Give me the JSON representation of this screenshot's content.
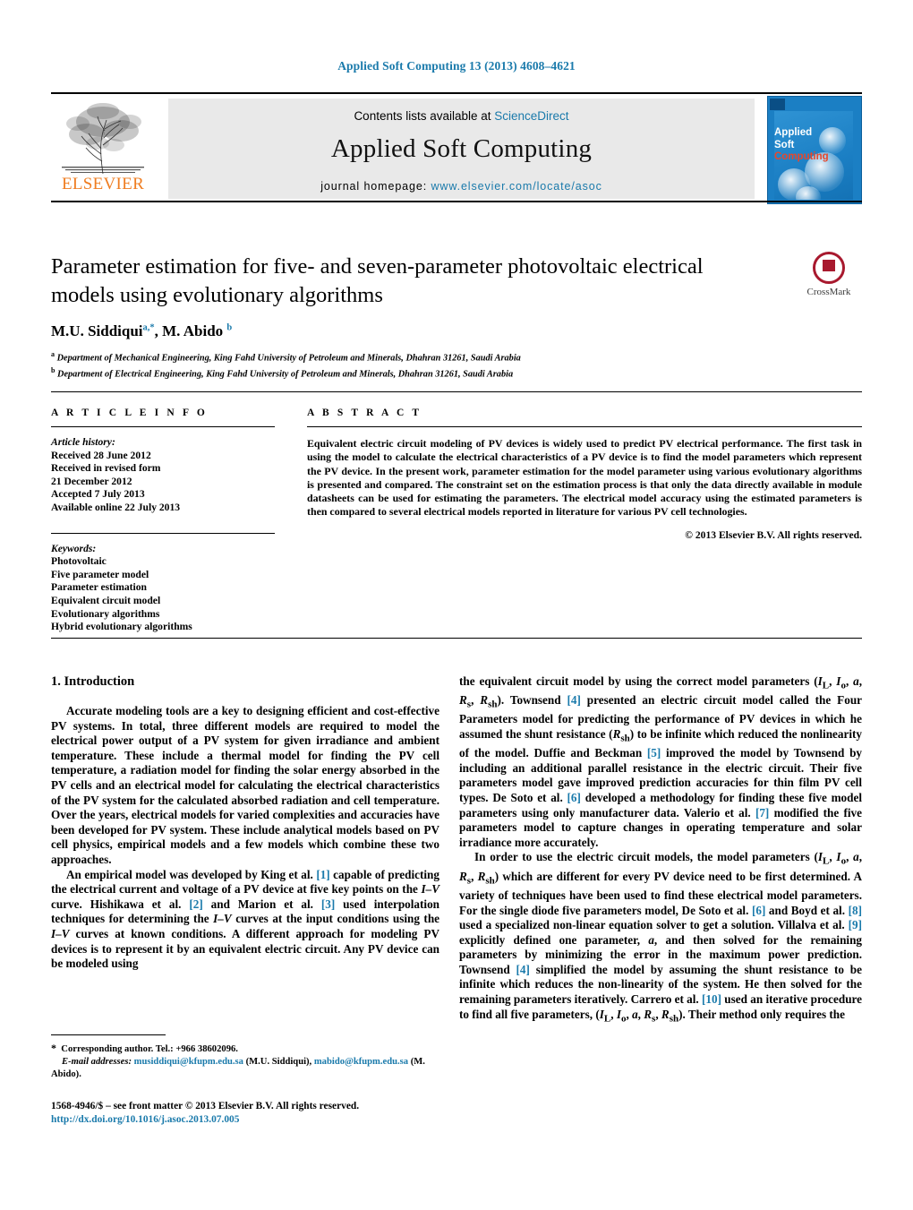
{
  "running_head": "Applied Soft Computing 13 (2013) 4608–4621",
  "masthead": {
    "contents_prefix": "Contents lists available at ",
    "sciencedirect": "ScienceDirect",
    "journal_title": "Applied Soft Computing",
    "homepage_prefix": "journal homepage: ",
    "homepage_url": "www.elsevier.com/locate/asoc",
    "publisher": "ELSEVIER",
    "cover": {
      "line1": "Applied",
      "line2": "Soft",
      "line3": "Computing"
    },
    "accent_color": "#1a7aab",
    "publisher_color": "#ef7d21",
    "cover_bg": "#1b7fc4",
    "cover_accent": "#e8472a"
  },
  "article": {
    "title": "Parameter estimation for five- and seven-parameter photovoltaic electrical models using evolutionary algorithms",
    "authors_html": "M.U. Siddiqui<sup>a,*</sup>, M. Abido <sup>b</sup>",
    "affiliation_a": "Department of Mechanical Engineering, King Fahd University of Petroleum and Minerals, Dhahran 31261, Saudi Arabia",
    "affiliation_b": "Department of Electrical Engineering, King Fahd University of Petroleum and Minerals, Dhahran 31261, Saudi Arabia",
    "crossmark_label": "CrossMark"
  },
  "article_info": {
    "heading": "A R T I C L E  I N F O",
    "history_label": "Article history:",
    "history": [
      "Received 28 June 2012",
      "Received in revised form",
      "21 December 2012",
      "Accepted 7 July 2013",
      "Available online 22 July 2013"
    ],
    "keywords_label": "Keywords:",
    "keywords": [
      "Photovoltaic",
      "Five parameter model",
      "Parameter estimation",
      "Equivalent circuit model",
      "Evolutionary algorithms",
      "Hybrid evolutionary algorithms"
    ]
  },
  "abstract": {
    "heading": "A B S T R A C T",
    "text": "Equivalent electric circuit modeling of PV devices is widely used to predict PV electrical performance. The first task in using the model to calculate the electrical characteristics of a PV device is to find the model parameters which represent the PV device. In the present work, parameter estimation for the model parameter using various evolutionary algorithms is presented and compared. The constraint set on the estimation process is that only the data directly available in module datasheets can be used for estimating the parameters. The electrical model accuracy using the estimated parameters is then compared to several electrical models reported in literature for various PV cell technologies.",
    "copyright": "© 2013 Elsevier B.V. All rights reserved."
  },
  "body": {
    "section_number_title": "1.  Introduction",
    "left_paragraph_1": "Accurate modeling tools are a key to designing efficient and cost-effective PV systems. In total, three different models are required to model the electrical power output of a PV system for given irradiance and ambient temperature. These include a thermal model for finding the PV cell temperature, a radiation model for finding the solar energy absorbed in the PV cells and an electrical model for calculating the electrical characteristics of the PV system for the calculated absorbed radiation and cell temperature. Over the years, electrical models for varied complexities and accuracies have been developed for PV system. These include analytical models based on PV cell physics, empirical models and a few models which combine these two approaches.",
    "left_paragraph_2_html": "An empirical model was developed by King et al. <span class=\"ref\">[1]</span> capable of predicting the electrical current and voltage of a PV device at five key points on the <span class=\"it\">I&ndash;V</span> curve. Hishikawa et al. <span class=\"ref\">[2]</span> and Marion et al. <span class=\"ref\">[3]</span> used interpolation techniques for determining the <span class=\"it\">I&ndash;V</span> curves at the input conditions using the <span class=\"it\">I&ndash;V</span> curves at known conditions. A different approach for modeling PV devices is to represent it by an equivalent electric circuit. Any PV device can be modeled using",
    "right_paragraph_1_html": "the equivalent circuit model by using the correct model parameters (<span class=\"it\">I</span><sub>L</sub>, <span class=\"it\">I</span><sub>o</sub>, <span class=\"it\">a</span>, <span class=\"it\">R</span><sub>s</sub>, <span class=\"it\">R</span><sub>sh</sub>). Townsend <span class=\"ref\">[4]</span> presented an electric circuit model called the Four Parameters model for predicting the performance of PV devices in which he assumed the shunt resistance (<span class=\"it\">R</span><sub>sh</sub>) to be infinite which reduced the nonlinearity of the model. Duffie and Beckman <span class=\"ref\">[5]</span> improved the model by Townsend by including an additional parallel resistance in the electric circuit. Their five parameters model gave improved prediction accuracies for thin film PV cell types. De Soto et al. <span class=\"ref\">[6]</span> developed a methodology for finding these five model parameters using only manufacturer data. Valerio et al. <span class=\"ref\">[7]</span> modified the five parameters model to capture changes in operating temperature and solar irradiance more accurately.",
    "right_paragraph_2_html": "In order to use the electric circuit models, the model parameters (<span class=\"it\">I</span><sub>L</sub>, <span class=\"it\">I</span><sub>o</sub>, <span class=\"it\">a</span>, <span class=\"it\">R</span><sub>s</sub>, <span class=\"it\">R</span><sub>sh</sub>) which are different for every PV device need to be first determined. A variety of techniques have been used to find these electrical model parameters. For the single diode five parameters model, De Soto et al. <span class=\"ref\">[6]</span> and Boyd et al. <span class=\"ref\">[8]</span> used a specialized non-linear equation solver to get a solution. Villalva et al. <span class=\"ref\">[9]</span> explicitly defined one parameter, <span class=\"it\">a</span>, and then solved for the remaining parameters by minimizing the error in the maximum power prediction. Townsend <span class=\"ref\">[4]</span> simplified the model by assuming the shunt resistance to be infinite which reduces the non-linearity of the system. He then solved for the remaining parameters iteratively. Carrero et al. <span class=\"ref\">[10]</span> used an iterative procedure to find all five parameters, (<span class=\"it\">I</span><sub>L</sub>, <span class=\"it\">I</span><sub>o</sub>, <span class=\"it\">a</span>, <span class=\"it\">R</span><sub>s</sub>, <span class=\"it\">R</span><sub>sh</sub>). Their method only requires the"
  },
  "footnote": {
    "corresponding_html": "<span style=\"font-size:12px\">*</span>&nbsp; Corresponding author. Tel.: +966 38602096.",
    "emails_html": "<span class=\"ital\">E-mail addresses:</span> <span class=\"link\">musiddiqui@kfupm.edu.sa</span> (M.U. Siddiqui), <span class=\"link\">mabido@kfupm.edu.sa</span> (M. Abido).",
    "imprint_line1": "1568-4946/$ – see front matter © 2013 Elsevier B.V. All rights reserved.",
    "imprint_doi": "http://dx.doi.org/10.1016/j.asoc.2013.07.005"
  }
}
